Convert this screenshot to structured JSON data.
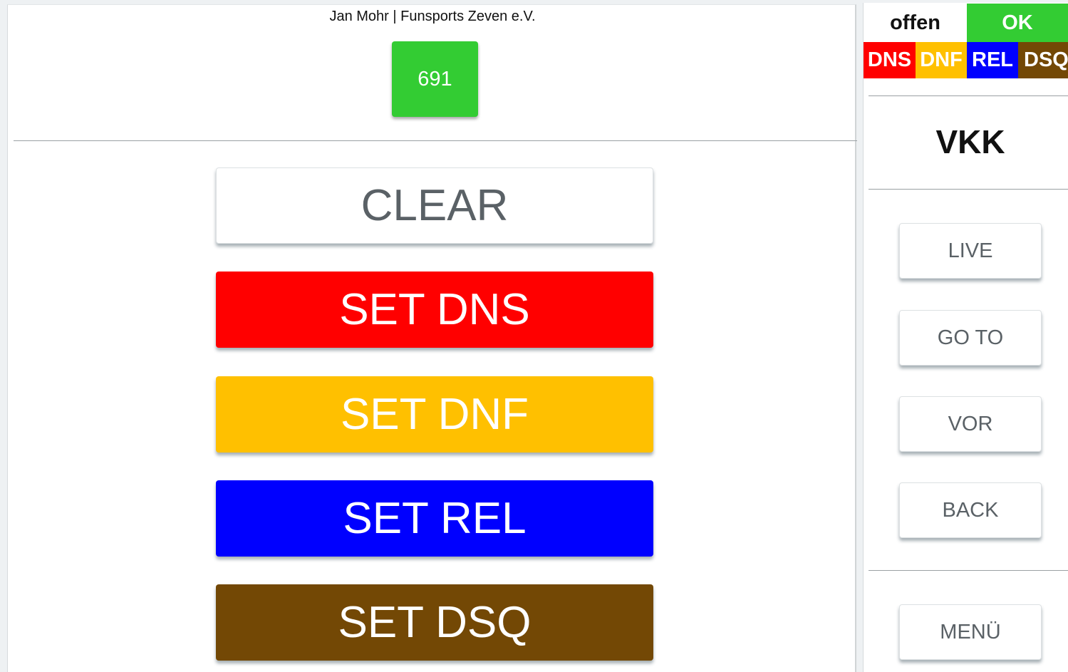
{
  "header": {
    "title": "Jan Mohr | Funsports Zeven e.V.",
    "bib_number": "691"
  },
  "actions": {
    "clear": "CLEAR",
    "set_dns": "SET DNS",
    "set_dnf": "SET DNF",
    "set_rel": "SET REL",
    "set_dsq": "SET DSQ"
  },
  "status_legend": {
    "offen": "offen",
    "ok": "OK",
    "dns": "DNS",
    "dnf": "DNF",
    "rel": "REL",
    "dsq": "DSQ"
  },
  "side": {
    "class_name": "VKK",
    "live": "LIVE",
    "goto": "GO TO",
    "vor": "VOR",
    "back": "BACK",
    "menu": "MENÜ"
  },
  "colors": {
    "ok_green": "#33cc33",
    "dns_red": "#ff0000",
    "dnf_amber": "#ffc000",
    "rel_blue": "#0000ff",
    "dsq_brown": "#734805"
  }
}
